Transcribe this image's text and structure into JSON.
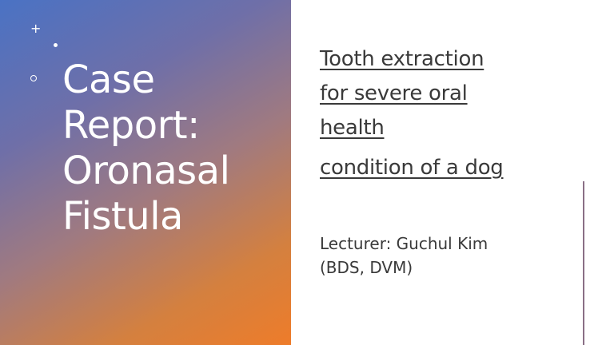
{
  "slide": {
    "title_lines": [
      "Case",
      "Report:",
      "Oronasal",
      "Fistula"
    ],
    "subtitle_lines": [
      "Tooth extraction",
      "for severe oral",
      "health",
      "condition of a dog"
    ],
    "lecturer_lines": [
      "Lecturer: Guchul Kim",
      "(BDS, DVM)"
    ]
  },
  "decorations": {
    "plus_glyph": "+"
  },
  "colors": {
    "gradient_start": "#4a72c4",
    "gradient_end": "#ee7c2a",
    "title_text": "#ffffff",
    "body_text": "#3a3a3a",
    "accent_line": "#8a6f86"
  }
}
